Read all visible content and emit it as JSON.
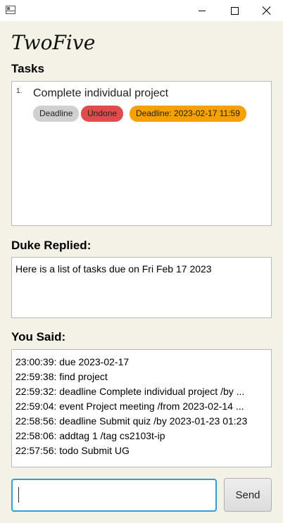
{
  "window": {
    "icon": "app-window-icon",
    "controls": [
      "minimize-icon",
      "maximize-icon",
      "close-icon"
    ]
  },
  "app": {
    "title": "TwoFive"
  },
  "tasks": {
    "heading": "Tasks",
    "items": [
      {
        "index": "1.",
        "description": "Complete individual project",
        "type_tag": "Deadline",
        "status_tag": "Undone",
        "date_tag": "Deadline: 2023-02-17 11:59"
      }
    ]
  },
  "reply": {
    "heading": "Duke Replied:",
    "text": "Here is a list of tasks due on Fri Feb 17 2023"
  },
  "said": {
    "heading": "You Said:",
    "history": [
      "23:00:39: due 2023-02-17",
      "22:59:38: find project",
      "22:59:32: deadline Complete individual project /by ...",
      "22:59:04: event Project meeting /from 2023-02-14 ...",
      "22:58:56: deadline Submit quiz /by 2023-01-23 01:23",
      "22:58:06: addtag 1 /tag cs2103t-ip",
      "22:57:56: todo Submit UG"
    ]
  },
  "input": {
    "value": "",
    "placeholder": ""
  },
  "send": {
    "label": "Send"
  },
  "colors": {
    "background": "#f4f1e6",
    "tag_type": "#d0d0d0",
    "tag_status_undone": "#e24b4b",
    "tag_date": "#f5a100",
    "input_focus": "#2f9fd8"
  }
}
